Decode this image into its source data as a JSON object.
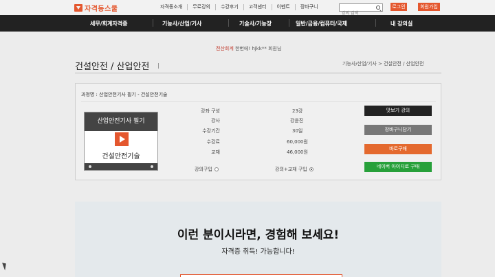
{
  "header": {
    "logo_text": "자격동스쿨",
    "nav": [
      "자격동소개",
      "무료강의",
      "수강후기",
      "고객센터",
      "이벤트",
      "장바구니"
    ],
    "search_placeholder": "강의 검색",
    "login_label": "로그인",
    "join_label": "회원가입"
  },
  "mainnav": {
    "items": [
      "세무/회계자격증",
      "기능사/산업/기사",
      "기술사/기능장",
      "일반/금융/컴퓨터/국제",
      "내 강의실"
    ]
  },
  "notice": {
    "highlight": "전산회계",
    "text": "한번에! hjkk** 회원님"
  },
  "page": {
    "title": "건설안전 / 산업안전",
    "breadcrumb": "기능사/산업/기사 > 건설안전 / 산업안전"
  },
  "course": {
    "name": "과정명 : 산업안전기사 필기 - 건설안전기술",
    "thumb_head": "산업안전기사 필기",
    "thumb_title": "건설안전기술",
    "info": [
      {
        "label": "강좌 구성",
        "value": "23강"
      },
      {
        "label": "강사",
        "value": "강윤진"
      },
      {
        "label": "수강기간",
        "value": "30일"
      },
      {
        "label": "수강료",
        "value": "60,000원"
      },
      {
        "label": "교재",
        "value": "46,000원"
      }
    ],
    "option_lecture": "강의구입",
    "option_bundle": "강의+교재 구입",
    "actions": {
      "preview": "맛보기 강의",
      "cart": "장바구니담기",
      "buy": "바로구매",
      "naver": "네이버 아이디로 구매"
    }
  },
  "promo": {
    "title": "이런 분이시라면, 경험해 보세요!",
    "subtitle": "자격증 취득! 가능합니다!"
  },
  "colors": {
    "accent": "#e4572e",
    "nav_bg": "#222222",
    "preview_btn": "#222222",
    "cart_btn": "#777777",
    "buy_btn": "#e4692e",
    "naver_btn": "#27a03a"
  }
}
